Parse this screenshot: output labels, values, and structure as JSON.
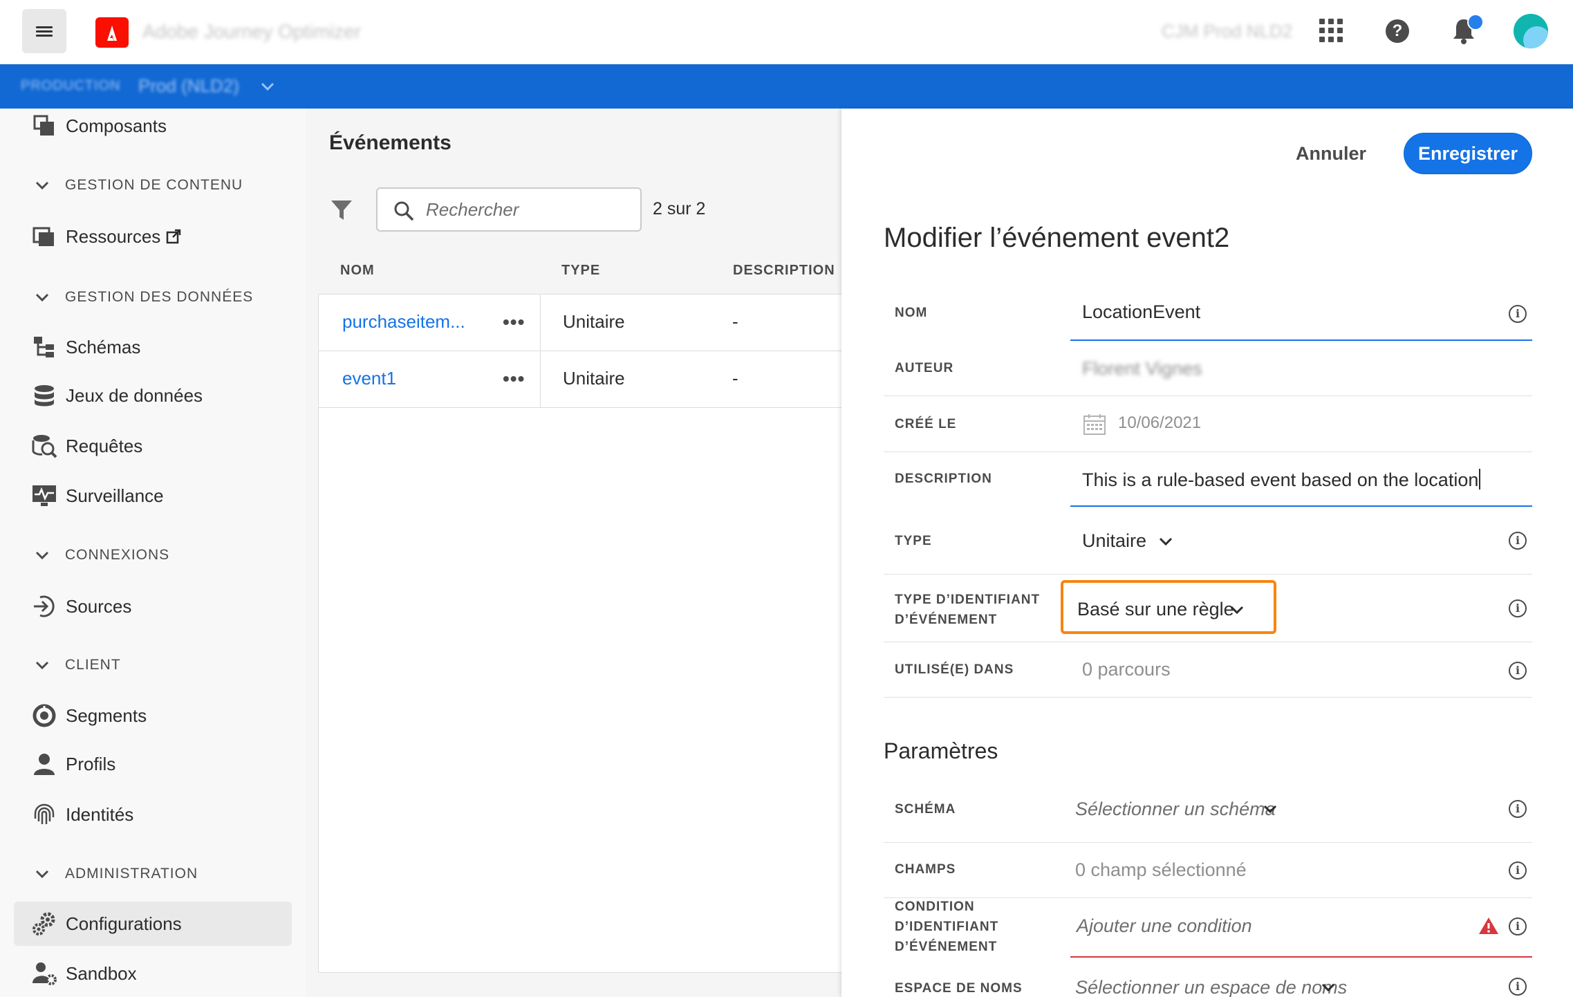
{
  "topbar": {
    "app_name": "Adobe Journey Optimizer",
    "org_name": "CJM Prod NLD2"
  },
  "envbar": {
    "label": "PRODUCTION",
    "name": "Prod (NLD2)"
  },
  "sidebar": {
    "components": "Composants",
    "section_content": "GESTION DE CONTENU",
    "resources": "Ressources",
    "section_data": "GESTION DES DONNÉES",
    "schemas": "Schémas",
    "datasets": "Jeux de données",
    "queries": "Requêtes",
    "monitoring": "Surveillance",
    "section_connections": "CONNEXIONS",
    "sources": "Sources",
    "section_customer": "CLIENT",
    "segments": "Segments",
    "profiles": "Profils",
    "identities": "Identités",
    "section_admin": "ADMINISTRATION",
    "configurations": "Configurations",
    "sandbox": "Sandbox"
  },
  "list": {
    "title": "Événements",
    "search_placeholder": "Rechercher",
    "count": "2 sur 2",
    "columns": {
      "name": "NOM",
      "type": "TYPE",
      "description": "DESCRIPTION"
    },
    "rows": [
      {
        "name": "purchaseitem...",
        "type": "Unitaire",
        "description": "-"
      },
      {
        "name": "event1",
        "type": "Unitaire",
        "description": "-"
      }
    ]
  },
  "edit": {
    "cancel": "Annuler",
    "save": "Enregistrer",
    "title": "Modifier l’événement event2",
    "fields": {
      "name_label": "NOM",
      "name_value": "LocationEvent",
      "author_label": "AUTEUR",
      "author_value": "Florent Vignes",
      "created_label": "CRÉÉ LE",
      "created_value": "10/06/2021",
      "description_label": "DESCRIPTION",
      "description_value": "This is a rule-based event based on the location",
      "type_label": "TYPE",
      "type_value": "Unitaire",
      "id_type_label_1": "TYPE D’IDENTIFIANT",
      "id_type_label_2": "D’ÉVÉNEMENT",
      "id_type_value": "Basé sur une règle",
      "used_label": "UTILISÉ(E) DANS",
      "used_value": "0 parcours"
    },
    "params_title": "Paramètres",
    "params": {
      "schema_label": "SCHÉMA",
      "schema_placeholder": "Sélectionner un schéma",
      "fields_label": "CHAMPS",
      "fields_value": "0 champ sélectionné",
      "condition_label_1": "CONDITION",
      "condition_label_2": "D’IDENTIFIANT",
      "condition_label_3": "D’ÉVÉNEMENT",
      "condition_placeholder": "Ajouter une condition",
      "namespace_label": "ESPACE DE NOMS",
      "namespace_placeholder": "Sélectionner un espace de noms"
    }
  },
  "colors": {
    "accent": "#1473e6",
    "env_bar": "#1269d3",
    "highlight": "#f68511",
    "error": "#d7373f"
  }
}
